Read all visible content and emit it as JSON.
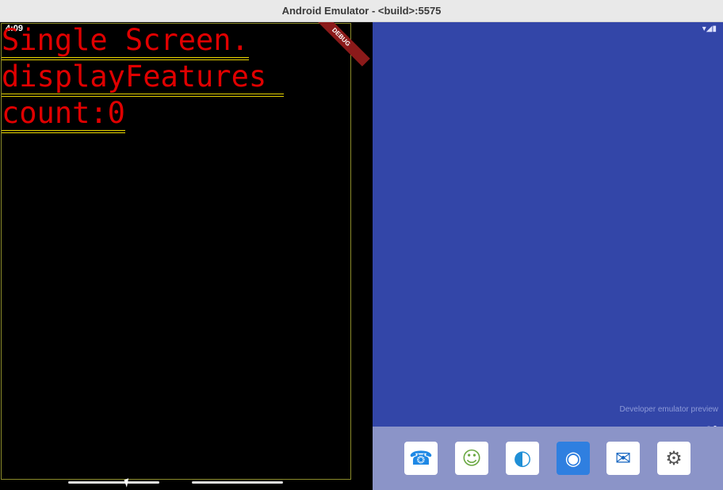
{
  "window": {
    "title": "Android Emulator - <build>:5575"
  },
  "left": {
    "time": "4:09",
    "debug_label": "DEBUG",
    "lines": [
      "Single Screen.",
      "displayFeatures ",
      "count:0"
    ]
  },
  "right": {
    "dev_preview": "Developer emulator preview",
    "status_icons": "▾◢▮",
    "dock": [
      {
        "name": "phone-app-icon",
        "glyph": "☎",
        "color": "#1e88e5"
      },
      {
        "name": "store-app-icon",
        "glyph": "☺",
        "color": "#6aa842"
      },
      {
        "name": "edge-app-icon",
        "glyph": "◐",
        "color": "#1f8fd6"
      },
      {
        "name": "camera-app-icon",
        "glyph": "◉",
        "color": "#ffffff"
      },
      {
        "name": "outlook-app-icon",
        "glyph": "✉",
        "color": "#1565c0"
      },
      {
        "name": "settings-app-icon",
        "glyph": "⚙",
        "color": "#555555"
      }
    ]
  }
}
